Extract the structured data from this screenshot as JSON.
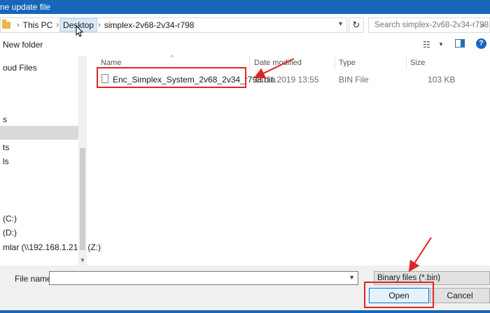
{
  "window": {
    "title": "ne update file"
  },
  "address": {
    "crumbs": [
      "This PC",
      "Desktop",
      "simplex-2v68-2v34-r798"
    ],
    "search_placeholder": "Search simplex-2v68-2v34-r798"
  },
  "toolbar": {
    "new_folder_label": "New folder",
    "help_label": "?"
  },
  "nav": {
    "items": [
      "oud Files",
      "s",
      "ts",
      "ls",
      "(C:)",
      "(D:)",
      "mlar (\\\\192.168.1.210) (Z:)"
    ]
  },
  "columns": {
    "name": "Name",
    "date": "Date modified",
    "type": "Type",
    "size": "Size"
  },
  "files": [
    {
      "name": "Enc_Simplex_System_2v68_2v34_r798.bin",
      "date": "13.11.2019 13:55",
      "type": "BIN File",
      "size": "103 KB"
    }
  ],
  "footer": {
    "file_name_label": "File name:",
    "file_name_value": "",
    "filter_value": "Binary files (*.bin)",
    "open_label": "Open",
    "cancel_label": "Cancel"
  },
  "colors": {
    "titlebar": "#1866b8",
    "annotation": "#e02424",
    "selected": "#d9d9d9"
  }
}
